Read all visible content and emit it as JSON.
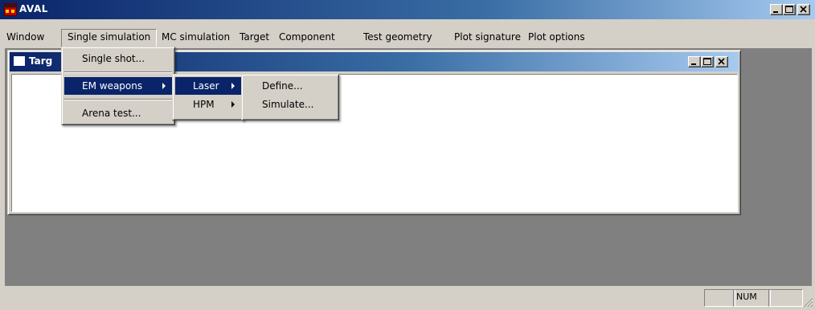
{
  "app": {
    "title": "AVAL"
  },
  "menubar": [
    {
      "label": "Window"
    },
    {
      "label": "Single simulation"
    },
    {
      "label": "MC simulation"
    },
    {
      "label": "Target"
    },
    {
      "label": "Component"
    },
    {
      "label": "Test geometry"
    },
    {
      "label": "Plot signature"
    },
    {
      "label": "Plot options"
    }
  ],
  "child_window": {
    "title": "Targ"
  },
  "single_simulation_menu": {
    "items": [
      {
        "label": "Single shot..."
      },
      {
        "label": "EM weapons"
      },
      {
        "label": "Arena test..."
      }
    ]
  },
  "em_weapons_menu": {
    "items": [
      {
        "label": "Laser"
      },
      {
        "label": "HPM"
      }
    ]
  },
  "laser_menu": {
    "items": [
      {
        "label": "Define..."
      },
      {
        "label": "Simulate..."
      }
    ]
  },
  "statusbar": {
    "panels": [
      "",
      "NUM",
      ""
    ]
  },
  "colors": {
    "titlebar_active": "#0a246a",
    "titlebar_fade": "#a6caf0",
    "menu_highlight": "#0a246a",
    "face": "#d4d0c8",
    "mdi_background": "#808080"
  }
}
